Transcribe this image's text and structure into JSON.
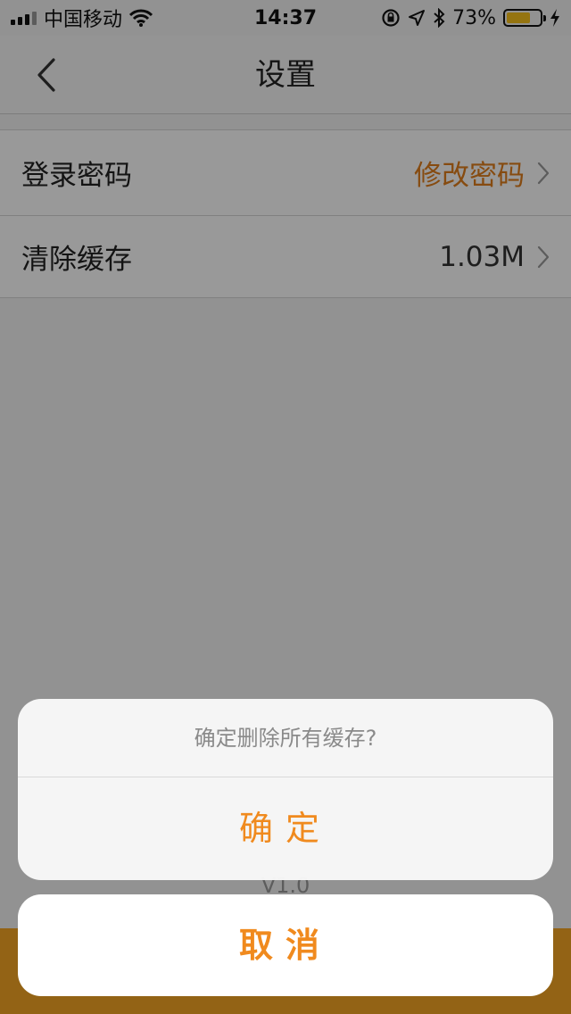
{
  "status_bar": {
    "carrier": "中国移动",
    "time": "14:37",
    "battery_percent": "73%",
    "battery_level": 0.73,
    "icons": [
      "signal-icon",
      "wifi-icon",
      "rotation-lock-icon",
      "location-icon",
      "bluetooth-icon",
      "battery-icon",
      "charging-icon"
    ]
  },
  "nav": {
    "title": "设置",
    "back_icon": "chevron-left-icon"
  },
  "settings": {
    "rows": [
      {
        "label": "登录密码",
        "value": "修改密码",
        "value_color": "#e07d1c"
      },
      {
        "label": "清除缓存",
        "value": "1.03M",
        "value_color": "#333333"
      }
    ]
  },
  "footer": {
    "version": "V1.0"
  },
  "action_sheet": {
    "message": "确定删除所有缓存?",
    "confirm_label": "确定",
    "cancel_label": "取消"
  },
  "colors": {
    "accent": "#f08a1e",
    "battery": "#f8c21c",
    "band": "#f5a623"
  }
}
